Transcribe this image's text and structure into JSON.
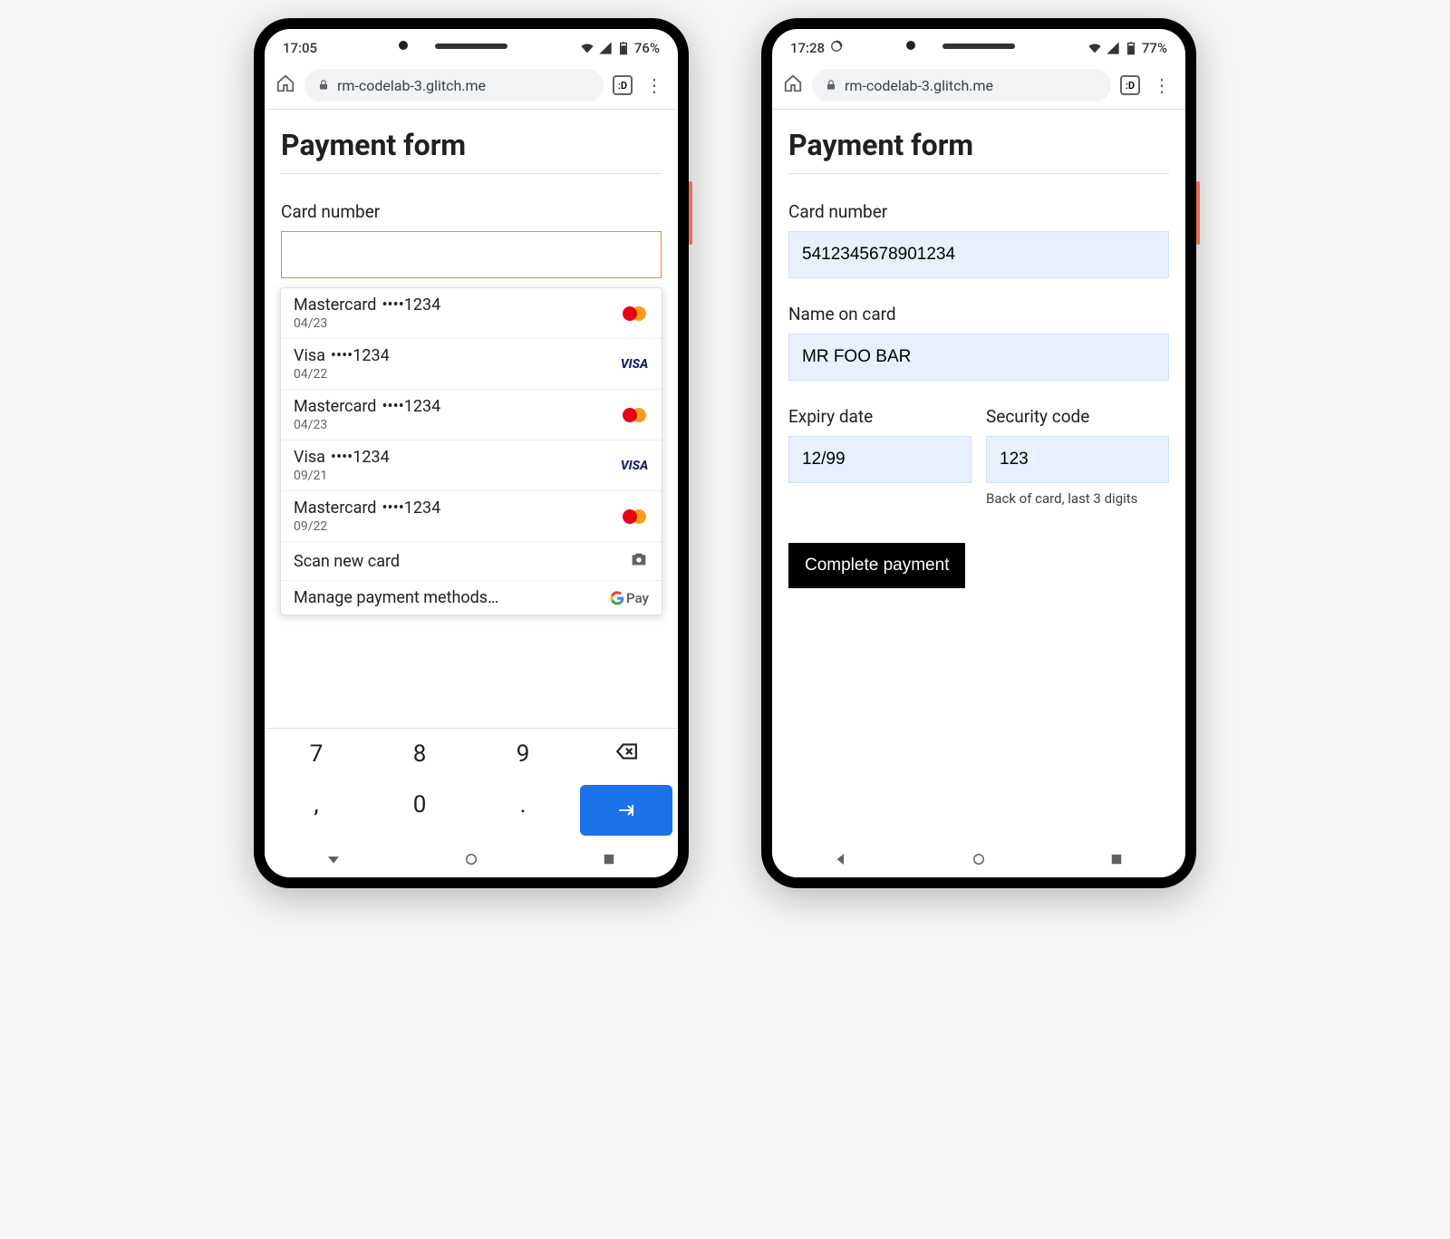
{
  "phone1": {
    "status": {
      "time": "17:05",
      "battery": "76%"
    },
    "browser": {
      "url": "rm-codelab-3.glitch.me",
      "tab_count": ":D"
    },
    "page": {
      "title": "Payment form",
      "card_number_label": "Card number",
      "card_number_value": ""
    },
    "autofill": {
      "cards": [
        {
          "brand": "Mastercard",
          "dots": "••••1234",
          "expiry": "04/23",
          "type": "mc"
        },
        {
          "brand": "Visa",
          "dots": "••••1234",
          "expiry": "04/22",
          "type": "visa"
        },
        {
          "brand": "Mastercard",
          "dots": "••••1234",
          "expiry": "04/23",
          "type": "mc"
        },
        {
          "brand": "Visa",
          "dots": "••••1234",
          "expiry": "09/21",
          "type": "visa"
        },
        {
          "brand": "Mastercard",
          "dots": "••••1234",
          "expiry": "09/22",
          "type": "mc"
        }
      ],
      "scan_label": "Scan new card",
      "manage_label": "Manage payment methods…",
      "gpay_label": "Pay"
    },
    "keyboard": {
      "keys": [
        "7",
        "8",
        "9",
        "bksp",
        ",",
        "0",
        ".",
        "enter"
      ]
    }
  },
  "phone2": {
    "status": {
      "time": "17:28",
      "battery": "77%"
    },
    "browser": {
      "url": "rm-codelab-3.glitch.me",
      "tab_count": ":D"
    },
    "page": {
      "title": "Payment form",
      "card_number_label": "Card number",
      "card_number_value": "5412345678901234",
      "name_label": "Name on card",
      "name_value": "MR FOO BAR",
      "expiry_label": "Expiry date",
      "expiry_value": "12/99",
      "cvc_label": "Security code",
      "cvc_value": "123",
      "cvc_hint": "Back of card, last 3 digits",
      "submit_label": "Complete payment"
    }
  }
}
